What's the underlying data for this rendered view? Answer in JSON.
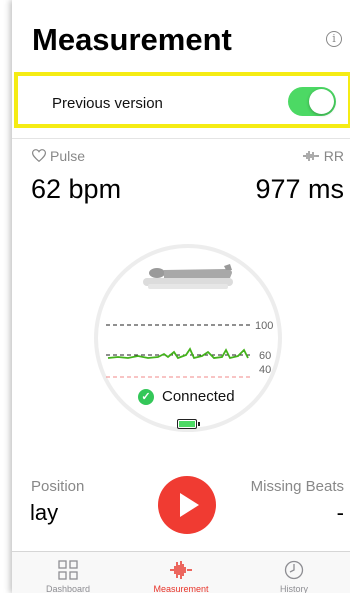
{
  "header": {
    "title": "Measurement",
    "info_icon": "info-icon"
  },
  "previous_version": {
    "label": "Previous version",
    "enabled": true,
    "highlight_color": "#f5ec14",
    "toggle_color": "#4cd964"
  },
  "pulse": {
    "label": "Pulse",
    "value": "62 bpm",
    "icon": "heart-outline-icon"
  },
  "rr": {
    "label": "RR",
    "value": "977 ms",
    "icon": "waveform-icon"
  },
  "monitor": {
    "scale": [
      "100",
      "60",
      "40"
    ],
    "status": "Connected",
    "battery_level": 0.9
  },
  "position": {
    "label": "Position",
    "value": "lay"
  },
  "missing_beats": {
    "label": "Missing Beats",
    "value": "-"
  },
  "play_button": {
    "icon": "play-icon",
    "color": "#f03b32"
  },
  "tabs": [
    {
      "label": "Dashboard",
      "icon": "grid-icon",
      "active": false
    },
    {
      "label": "Measurement",
      "icon": "waveform-icon",
      "active": true
    },
    {
      "label": "History",
      "icon": "clock-icon",
      "active": false
    }
  ],
  "accent_color": "#e8352b"
}
